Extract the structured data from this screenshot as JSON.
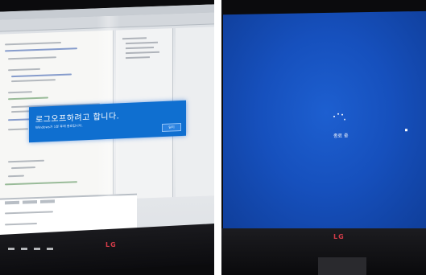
{
  "left_photo": {
    "dialog": {
      "title": "로그오프하려고 합니다.",
      "message": "Windows가 1분 후에 종료됩니다.",
      "button_label": "닫기",
      "color": "#0f6fd0"
    },
    "monitor_brand": "LG"
  },
  "right_photo": {
    "status_text": "종료 중",
    "background_color": "#1650bd",
    "monitor_brand": "LG"
  }
}
